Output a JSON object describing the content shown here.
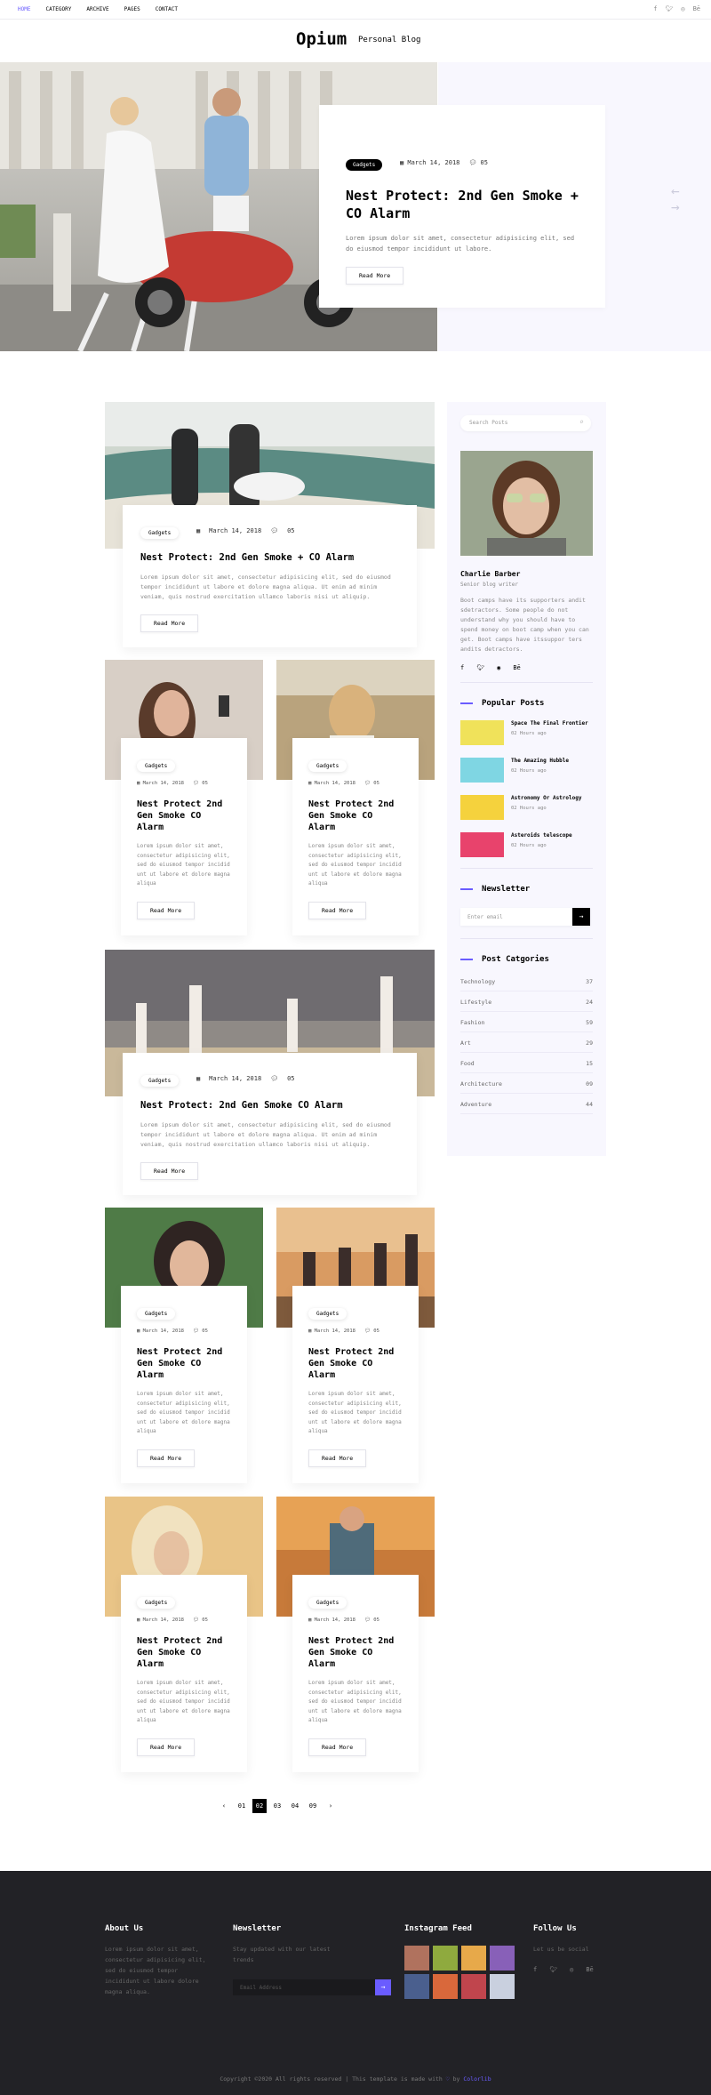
{
  "nav": {
    "items": [
      "HOME",
      "CATEGORY",
      "ARCHIVE",
      "PAGES",
      "CONTACT"
    ]
  },
  "social_icons": [
    "facebook-icon",
    "twitter-icon",
    "dribbble-icon",
    "behance-icon"
  ],
  "brand": {
    "logo": "Opium",
    "tagline": "Personal Blog"
  },
  "hero": {
    "badge": "Gadgets",
    "date": "March 14, 2018",
    "comments": "05",
    "title": "Nest Protect: 2nd Gen Smoke + CO Alarm",
    "desc": "Lorem ipsum dolor sit amet, consectetur adipisicing elit, sed do eiusmod tempor incididunt ut labore.",
    "button": "Read More",
    "arrow_prev": "←",
    "arrow_next": "→"
  },
  "post1": {
    "badge": "Gadgets",
    "date": "March 14, 2018",
    "comments": "05",
    "title": "Nest Protect: 2nd Gen Smoke + CO Alarm",
    "desc": "Lorem ipsum dolor sit amet, consectetur adipisicing elit, sed do eiusmod tempor incididunt ut labore et dolore magna aliqua. Ut enim ad minim veniam, quis nostrud exercitation ullamco laboris nisi ut aliquip.",
    "button": "Read More"
  },
  "post_wide2": {
    "badge": "Gadgets",
    "date": "March 14, 2018",
    "comments": "05",
    "title": "Nest Protect: 2nd Gen Smoke CO Alarm",
    "desc": "Lorem ipsum dolor sit amet, consectetur adipisicing elit, sed do eiusmod tempor incididunt ut labore et dolore magna aliqua. Ut enim ad minim veniam, quis nostrud exercitation ullamco laboris nisi ut aliquip.",
    "button": "Read More"
  },
  "small_post": {
    "badge": "Gadgets",
    "date": "March 14, 2018",
    "comments": "05",
    "title": "Nest Protect 2nd Gen Smoke CO Alarm",
    "desc": "Lorem ipsum dolor sit amet, consectetur adipisicing elit, sed do eiusmod tempor incidid unt ut labore et dolore magna aliqua",
    "button": "Read More"
  },
  "sidebar": {
    "search_placeholder": "Search Posts",
    "author": {
      "name": "Charlie Barber",
      "role": "Senior blog writer",
      "bio": "Boot camps have its supporters andit sdetractors. Some people do not understand why you should have to spend money on boot camp when you can get. Boot camps have itssuppor ters andits detractors."
    },
    "popular_heading": "Popular Posts",
    "popular": [
      {
        "title": "Space The Final Frontier",
        "time": "02 Hours ago"
      },
      {
        "title": "The Amazing Hubble",
        "time": "02 Hours ago"
      },
      {
        "title": "Astronomy Or Astrology",
        "time": "02 Hours ago"
      },
      {
        "title": "Asteroids telescope",
        "time": "02 Hours ago"
      }
    ],
    "newsletter_heading": "Newsletter",
    "newsletter_placeholder": "Enter email",
    "categories_heading": "Post Catgories",
    "categories": [
      {
        "name": "Technology",
        "count": "37"
      },
      {
        "name": "Lifestyle",
        "count": "24"
      },
      {
        "name": "Fashion",
        "count": "59"
      },
      {
        "name": "Art",
        "count": "29"
      },
      {
        "name": "Food",
        "count": "15"
      },
      {
        "name": "Architecture",
        "count": "09"
      },
      {
        "name": "Adventure",
        "count": "44"
      }
    ]
  },
  "pagination": {
    "pages": [
      "01",
      "02",
      "03",
      "04",
      "09"
    ],
    "prev": "‹",
    "next": "›"
  },
  "footer": {
    "about_heading": "About Us",
    "about_text": "Lorem ipsum dolor sit amet, consectetur adipisicing elit, sed do eiusmod tempor incididunt ut labore dolore magna aliqua.",
    "newsletter_heading": "Newsletter",
    "newsletter_text": "Stay updated with our latest trends",
    "email_placeholder": "Email Address",
    "insta_heading": "Instagram Feed",
    "follow_heading": "Follow Us",
    "follow_text": "Let us be social",
    "copyright_pre": "Copyright ©2020 All rights reserved | This template is made with",
    "copyright_by": "by",
    "copyright_link": "Colorlib"
  },
  "colors": {
    "accent": "#6a5cff",
    "sidebar_bg": "#f8f7fe",
    "footer_bg": "#222226"
  }
}
